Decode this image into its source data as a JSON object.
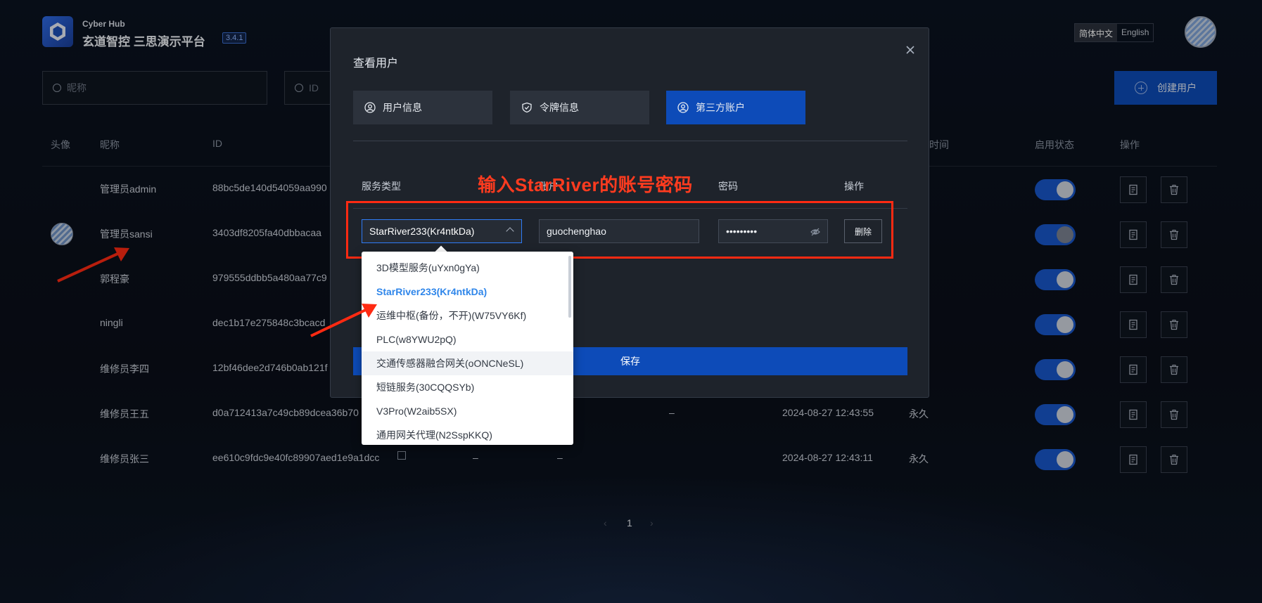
{
  "header": {
    "brand_en": "Cyber Hub",
    "brand_zh": "玄道智控 三思演示平台",
    "version": "3.4.1",
    "lang_zh": "简体中文",
    "lang_en": "English"
  },
  "filters": {
    "nickname_placeholder": "昵称",
    "id_placeholder": "ID",
    "create_label": "创建用户"
  },
  "table": {
    "headers": {
      "avatar": "头像",
      "nickname": "昵称",
      "id": "ID",
      "time_partial": "时间",
      "status": "启用状态",
      "ops": "操作"
    },
    "rows": [
      {
        "nickname": "管理员admin",
        "id": "88bc5de140d54059aa990",
        "c1": "",
        "c2": "",
        "time": "",
        "expire": "",
        "enabled": true
      },
      {
        "nickname": "管理员sansi",
        "id": "3403df8205fa40dbbacaa",
        "c1": "",
        "c2": "",
        "time": "",
        "expire": "",
        "enabled": false
      },
      {
        "nickname": "郭程豪",
        "id": "979555ddbb5a480aa77c9",
        "c1": "",
        "c2": "",
        "time": "",
        "expire": "",
        "enabled": true
      },
      {
        "nickname": "ningli",
        "id": "dec1b17e275848c3bcacd",
        "c1": "",
        "c2": "",
        "time": "",
        "expire": "",
        "enabled": true
      },
      {
        "nickname": "维修员李四",
        "id": "12bf46dee2d746b0ab121f",
        "c1": "",
        "c2": "",
        "time": "",
        "expire": "",
        "enabled": true
      },
      {
        "nickname": "维修员王五",
        "id": "d0a712413a7c49cb89dcea36b70",
        "c1": "",
        "c2": "–",
        "time": "2024-08-27 12:43:55",
        "expire": "永久",
        "enabled": true
      },
      {
        "nickname": "维修员张三",
        "id": "ee610c9fdc9e40fc89907aed1e9a1dcc",
        "c1": "–",
        "c2": "–",
        "time": "2024-08-27 12:43:11",
        "expire": "永久",
        "enabled": true
      }
    ]
  },
  "pager": {
    "prev": "‹",
    "page": "1",
    "next": "›"
  },
  "modal": {
    "title": "查看用户",
    "tabs": [
      {
        "label": "用户信息"
      },
      {
        "label": "令牌信息"
      },
      {
        "label": "第三方账户"
      }
    ],
    "columns": {
      "service": "服务类型",
      "account": "账户",
      "password": "密码",
      "ops": "操作"
    },
    "annotation": "输入StarRiver的账号密码",
    "row": {
      "service_value": "StarRiver233(Kr4ntkDa)",
      "account_value": "guochenghao",
      "password_value": "•••••••••",
      "delete_label": "删除"
    },
    "save_label": "保存"
  },
  "dropdown": {
    "options": [
      "3D模型服务(uYxn0gYa)",
      "StarRiver233(Kr4ntkDa)",
      "运维中枢(备份，不开)(W75VY6Kf)",
      "PLC(w8YWU2pQ)",
      "交通传感器融合网关(oONCNeSL)",
      "短链服务(30CQQSYb)",
      "V3Pro(W2aib5SX)",
      "通用网关代理(N2SspKKQ)"
    ],
    "selected_index": 1,
    "hover_index": 4
  },
  "colors": {
    "accent": "#0d4bb8",
    "annotation": "#ff2a12",
    "selected_option": "#2f86ea"
  }
}
